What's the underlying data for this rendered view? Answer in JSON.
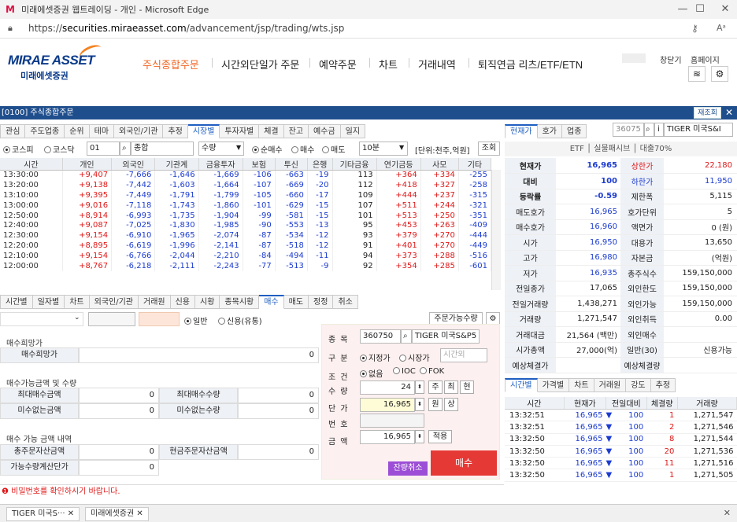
{
  "browser": {
    "title": "미래에셋증권 웹트레이딩 - 개인 - Microsoft Edge",
    "url_prefix": "https://",
    "url_host": "securities.miraeasset.com",
    "url_path": "/advancement/jsp/trading/wts.jsp",
    "min": "—",
    "max": "☐",
    "close": "✕"
  },
  "header": {
    "brand_en": "MIRAE ASSET",
    "brand_kr": "미래에셋증권",
    "nav": [
      "주식종합주문",
      "시간외단일가 주문",
      "예약주문",
      "차트",
      "거래내역",
      "퇴직연금 리츠/ETF/ETN"
    ],
    "link_close": "창닫기",
    "link_home": "홈페이지"
  },
  "window": {
    "title": "[0100] 주식종합주문",
    "refresh": "재조회",
    "close": "✕"
  },
  "top_tabs": [
    "관심",
    "주도업종",
    "순위",
    "테마",
    "외국인/기관",
    "추정",
    "시장별",
    "투자자별",
    "체결",
    "잔고",
    "예수금",
    "일지"
  ],
  "filter": {
    "kospi": "코스피",
    "kosdaq": "코스닥",
    "code": "01",
    "name": "종합",
    "qty": "수량",
    "net": "순매수",
    "buy": "매수",
    "sell": "매도",
    "interval": "10분",
    "unit": "[단위:천주,억원]",
    "query": "조회"
  },
  "grid": {
    "headers": [
      "시간",
      "개인",
      "외국인",
      "기관계",
      "금융투자",
      "보험",
      "투신",
      "은행",
      "기타금융",
      "연기금등",
      "사모",
      "기타"
    ],
    "rows": [
      [
        "13:30:00",
        "+9,407",
        "-7,666",
        "-1,646",
        "-1,669",
        "-106",
        "-663",
        "-19",
        "113",
        "+364",
        "+334",
        "-255"
      ],
      [
        "13:20:00",
        "+9,138",
        "-7,442",
        "-1,603",
        "-1,664",
        "-107",
        "-669",
        "-20",
        "112",
        "+418",
        "+327",
        "-258"
      ],
      [
        "13:10:00",
        "+9,395",
        "-7,449",
        "-1,791",
        "-1,799",
        "-105",
        "-660",
        "-17",
        "109",
        "+444",
        "+237",
        "-315"
      ],
      [
        "13:00:00",
        "+9,016",
        "-7,118",
        "-1,743",
        "-1,860",
        "-101",
        "-629",
        "-15",
        "107",
        "+511",
        "+244",
        "-321"
      ],
      [
        "12:50:00",
        "+8,914",
        "-6,993",
        "-1,735",
        "-1,904",
        "-99",
        "-581",
        "-15",
        "101",
        "+513",
        "+250",
        "-351"
      ],
      [
        "12:40:00",
        "+9,087",
        "-7,025",
        "-1,830",
        "-1,985",
        "-90",
        "-553",
        "-13",
        "95",
        "+453",
        "+263",
        "-409"
      ],
      [
        "12:30:00",
        "+9,154",
        "-6,910",
        "-1,965",
        "-2,074",
        "-87",
        "-534",
        "-12",
        "93",
        "+379",
        "+270",
        "-444"
      ],
      [
        "12:20:00",
        "+8,895",
        "-6,619",
        "-1,996",
        "-2,141",
        "-87",
        "-518",
        "-12",
        "91",
        "+401",
        "+270",
        "-449"
      ],
      [
        "12:10:00",
        "+9,154",
        "-6,766",
        "-2,044",
        "-2,210",
        "-84",
        "-494",
        "-11",
        "94",
        "+373",
        "+288",
        "-516"
      ],
      [
        "12:00:00",
        "+8,767",
        "-6,218",
        "-2,111",
        "-2,243",
        "-77",
        "-513",
        "-9",
        "92",
        "+354",
        "+285",
        "-601"
      ]
    ]
  },
  "mid_tabs": [
    "시간별",
    "일자별",
    "차트",
    "외국인/기관",
    "거래원",
    "신용",
    "시황",
    "종목시황",
    "매수",
    "매도",
    "정정",
    "취소"
  ],
  "order": {
    "general": "일반",
    "credit": "신용(유통)",
    "avail_btn": "주문가능수량",
    "gear": "⚙",
    "sec1": "매수희망가",
    "hope_label": "매수희망가",
    "hope_val": "0",
    "sec2": "매수가능금액 및 수량",
    "max_amt_l": "최대매수금액",
    "max_amt_v": "0",
    "max_qty_l": "최대매수수량",
    "max_qty_v": "0",
    "short_amt_l": "미수없는금액",
    "short_amt_v": "0",
    "short_qty_l": "미수없는수량",
    "short_qty_v": "0",
    "sec3": "매수 가능 금액 내역",
    "total_l": "총주문자산금액",
    "total_v": "0",
    "cash_l": "현금주문자산금액",
    "cash_v": "0",
    "calc_l": "가능수량계산단가",
    "calc_v": "0",
    "f_item": "종목",
    "item_code": "360750",
    "item_name": "TIGER 미국S&P5",
    "f_type": "구분",
    "t_limit": "지정가",
    "t_market": "시장가",
    "t_after": "시간외",
    "f_cond": "조건",
    "c_none": "없음",
    "c_ioc": "IOC",
    "c_fok": "FOK",
    "f_qty": "수량",
    "qty": "24",
    "b_qty1": "주",
    "b_qty2": "최",
    "b_qty3": "현",
    "f_price": "단가",
    "price": "16,965",
    "b_pr1": "원",
    "b_pr2": "상",
    "f_pw": "번호",
    "f_amt": "금액",
    "amt": "16,965",
    "b_apply": "적용",
    "cancel_rest": "잔량취소",
    "buy": "매수"
  },
  "status": "비밀번호를 확인하시기 바랍니다.",
  "right": {
    "tabs": [
      "현재가",
      "호가",
      "업종"
    ],
    "code": "36075",
    "name": "TIGER 미국S&I",
    "sub": [
      "ETF",
      "실물패시브",
      "대출70%"
    ],
    "quote": [
      [
        "현재가",
        "16,965",
        "상한가",
        "22,180"
      ],
      [
        "대비",
        "100",
        "하한가",
        "11,950"
      ],
      [
        "등락률",
        "-0.59",
        "제한폭",
        "5,115"
      ],
      [
        "매도호가",
        "16,965",
        "호가단위",
        "5"
      ],
      [
        "매수호가",
        "16,960",
        "액면가",
        "0 (원)"
      ],
      [
        "시가",
        "16,950",
        "대용가",
        "13,650"
      ],
      [
        "고가",
        "16,980",
        "자본금",
        "(억원)"
      ],
      [
        "저가",
        "16,935",
        "총주식수",
        "159,150,000"
      ],
      [
        "전일종가",
        "17,065",
        "외인한도",
        "159,150,000"
      ],
      [
        "전일거래량",
        "1,438,271",
        "외인가능",
        "159,150,000"
      ],
      [
        "거래량",
        "1,271,547",
        "외인취득",
        "0.00"
      ],
      [
        "거래대금",
        "21,564 (백만)",
        "외인매수",
        ""
      ],
      [
        "시가총액",
        "27,000(억)",
        "일반(30)",
        "신용가능"
      ],
      [
        "예상체결가",
        "",
        "예상체결량",
        ""
      ]
    ],
    "trade_tabs": [
      "시간별",
      "가격별",
      "차트",
      "거래원",
      "강도",
      "추정"
    ],
    "trade_headers": [
      "시간",
      "현재가",
      "전일대비",
      "체결량",
      "거래량"
    ],
    "trades": [
      [
        "13:32:51",
        "16,965",
        "100",
        "1",
        "1,271,547"
      ],
      [
        "13:32:51",
        "16,965",
        "100",
        "2",
        "1,271,546"
      ],
      [
        "13:32:50",
        "16,965",
        "100",
        "8",
        "1,271,544"
      ],
      [
        "13:32:50",
        "16,965",
        "100",
        "20",
        "1,271,536"
      ],
      [
        "13:32:50",
        "16,965",
        "100",
        "11",
        "1,271,516"
      ],
      [
        "13:32:50",
        "16,965",
        "100",
        "1",
        "1,271,505"
      ]
    ]
  },
  "bottom_tabs": [
    "TIGER 미국S···",
    "미래에셋증권"
  ],
  "colors": {
    "accent": "#1f4e8c",
    "up": "#e01818",
    "down": "#1c3cd0",
    "buy": "#e53935",
    "cancel": "#9c4ed6"
  }
}
